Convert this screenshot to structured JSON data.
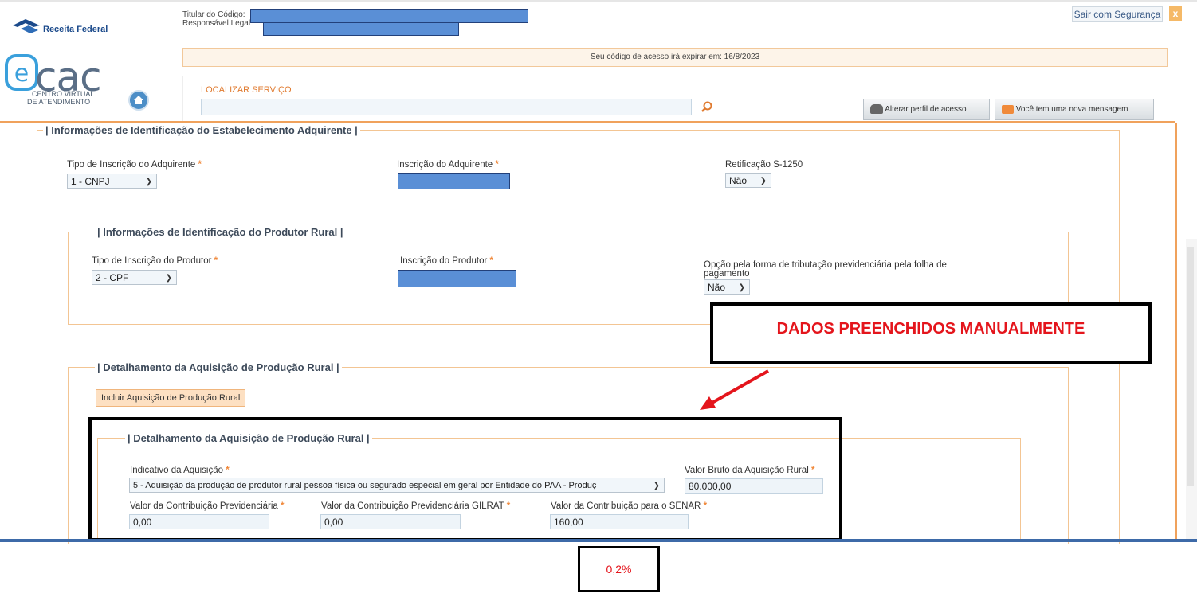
{
  "header": {
    "receita_label": "Receita Federal",
    "ecac_logo_text": "cac",
    "ecac_sub1": "CENTRO VIRTUAL",
    "ecac_sub2": "DE ATENDIMENTO",
    "titular_label": "Titular do Código:",
    "responsavel_label": "Responsável Legal:",
    "expiry_text": "Seu código de acesso irá expirar em: 16/8/2023",
    "logout_label": "Sair com Segurança",
    "close_label": "x",
    "search_label": "LOCALIZAR SERVIÇO",
    "search_value": "",
    "profile_button": "Alterar perfil de acesso",
    "message_button": "Você tem uma nova mensagem"
  },
  "section_estabelecimento": {
    "legend": "| Informações de Identificação do Estabelecimento Adquirente |",
    "tipo_label": "Tipo de Inscrição do Adquirente",
    "tipo_value": "1 - CNPJ",
    "inscricao_label": "Inscrição do Adquirente",
    "retificacao_label": "Retificação S-1250",
    "retificacao_value": "Não"
  },
  "section_produtor": {
    "legend": "| Informações de Identificação do Produtor Rural |",
    "tipo_label": "Tipo de Inscrição do Produtor",
    "tipo_value": "2 - CPF",
    "inscricao_label": "Inscrição do Produtor",
    "opcao_label_line1": "Opção pela forma de tributação previdenciária pela folha de",
    "opcao_label_line2": "pagamento",
    "opcao_value": "Não"
  },
  "section_detalhamento": {
    "legend": "| Detalhamento da Aquisição de Produção Rural |",
    "incluir_button": "Incluir Aquisição de Produção Rural"
  },
  "subsection_detalhamento": {
    "legend": "| Detalhamento da Aquisição de Produção Rural |",
    "indicativo_label": "Indicativo da Aquisição",
    "indicativo_value": "5 - Aquisição da produção de produtor rural pessoa física ou segurado especial em geral por Entidade do PAA - Produç",
    "valor_bruto_label": "Valor Bruto da Aquisição Rural",
    "valor_bruto_value": "80.000,00",
    "contrib_prev_label": "Valor da Contribuição Previdenciária",
    "contrib_prev_value": "0,00",
    "contrib_gilrat_label": "Valor da Contribuição Previdenciária GILRAT",
    "contrib_gilrat_value": "0,00",
    "contrib_senar_label": "Valor da Contribuição para o SENAR",
    "contrib_senar_value": "160,00"
  },
  "annotations": {
    "dados_text": "DADOS PREENCHIDOS MANUALMENTE",
    "percent_text": "0,2%",
    "annotation_color": "#e4151c"
  },
  "required_star": "*",
  "colors": {
    "accent_orange": "#f0a25c",
    "redaction_blue": "#5a8fd6",
    "ecac_blue": "#3aa0dc"
  }
}
